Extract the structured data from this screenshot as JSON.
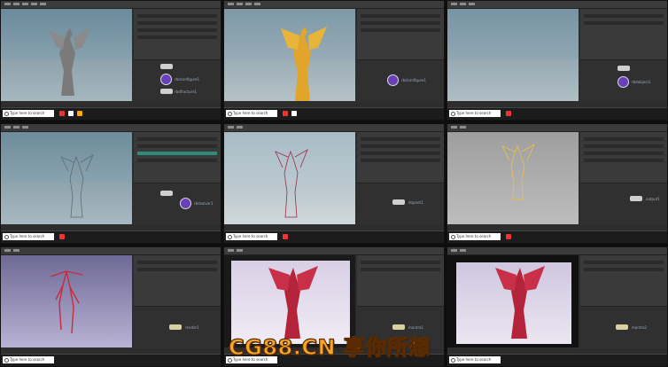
{
  "tiles": [
    {
      "id": "r1c1",
      "viewport": "bg-blue",
      "statue": "grey",
      "search": "Type here to search",
      "nodes": [
        "rbdconfigure1",
        "rbdfracture1"
      ]
    },
    {
      "id": "r1c2",
      "viewport": "bg-blue",
      "statue": "gold",
      "search": "Type here to search",
      "nodes": [
        "rbdconfigure1"
      ]
    },
    {
      "id": "r1c3",
      "viewport": "bg-blue",
      "statue": "none",
      "search": "Type here to search",
      "nodes": [
        "rbdobject1"
      ]
    },
    {
      "id": "r2c1",
      "viewport": "bg-blue",
      "statue": "wire",
      "search": "Type here to search",
      "nodes": [
        "rbdsolver1"
      ]
    },
    {
      "id": "r2c2",
      "viewport": "bg-blue-light",
      "statue": "wire-red",
      "search": "Type here to search",
      "nodes": [
        "dopnet1"
      ]
    },
    {
      "id": "r2c3",
      "viewport": "bg-grey",
      "statue": "gold-wire",
      "search": "Type here to search",
      "nodes": [
        "output1"
      ]
    },
    {
      "id": "r3c1",
      "viewport": "bg-purple",
      "statue": "red-root",
      "search": "Type here to search",
      "nodes": [
        "render1"
      ]
    },
    {
      "id": "r3c2",
      "viewport": "bg-render",
      "statue": "red-full",
      "search": "Type here to search",
      "nodes": [
        "mantra1"
      ]
    },
    {
      "id": "r3c3",
      "viewport": "bg-render-dark",
      "statue": "red-full",
      "search": "Type here to search",
      "nodes": [
        "mantra2"
      ]
    }
  ],
  "watermark": "CG88.CN 享你所想",
  "colors": {
    "watermark": "#f5a623",
    "node_accent": "#6a3fb8",
    "gold": "#e0a52a",
    "red": "#c82a3c"
  },
  "icons": [
    "search-icon",
    "windows-icon",
    "houdini-node-icon"
  ]
}
